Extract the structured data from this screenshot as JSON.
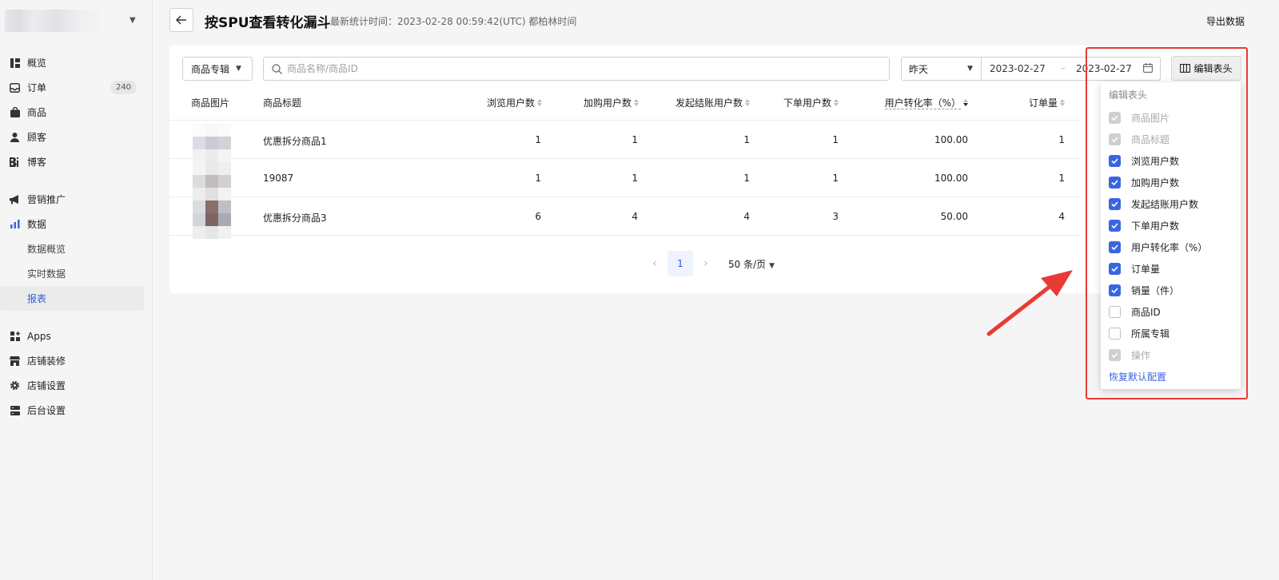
{
  "sidebar": {
    "items": [
      {
        "label": "概览",
        "icon": "overview-icon"
      },
      {
        "label": "订单",
        "icon": "inbox-icon",
        "badge": "240"
      },
      {
        "label": "商品",
        "icon": "bag-icon"
      },
      {
        "label": "顾客",
        "icon": "user-icon"
      },
      {
        "label": "博客",
        "icon": "blog-icon"
      },
      {
        "label": "营销推广",
        "icon": "megaphone-icon"
      },
      {
        "label": "数据",
        "icon": "bar-chart-icon",
        "children": [
          "数据概览",
          "实时数据",
          "报表"
        ]
      },
      {
        "label": "Apps",
        "icon": "apps-icon"
      },
      {
        "label": "店铺装修",
        "icon": "store-icon"
      },
      {
        "label": "店铺设置",
        "icon": "gear-icon"
      },
      {
        "label": "后台设置",
        "icon": "server-icon"
      }
    ],
    "active_sub": "报表"
  },
  "header": {
    "title": "按SPU查看转化漏斗",
    "subtitle": "最新统计时间：2023-02-28 00:59:42(UTC) 都柏林时间",
    "export": "导出数据"
  },
  "filters": {
    "collection_select": "商品专辑",
    "search_placeholder": "商品名称/商品ID",
    "date_preset": "昨天",
    "date_start": "2023-02-27",
    "date_sep": "–",
    "date_end": "2023-02-27",
    "edit_columns": "编辑表头"
  },
  "table": {
    "columns": [
      "商品图片",
      "商品标题",
      "浏览用户数",
      "加购用户数",
      "发起结账用户数",
      "下单用户数",
      "用户转化率（%）",
      "订单量"
    ],
    "rows": [
      {
        "title": "优惠拆分商品1",
        "views": "1",
        "cart": "1",
        "checkout": "1",
        "orders_users": "1",
        "rate": "100.00",
        "orders": "1"
      },
      {
        "title": "19087",
        "views": "1",
        "cart": "1",
        "checkout": "1",
        "orders_users": "1",
        "rate": "100.00",
        "orders": "1"
      },
      {
        "title": "优惠拆分商品3",
        "views": "6",
        "cart": "4",
        "checkout": "4",
        "orders_users": "3",
        "rate": "50.00",
        "orders": "4"
      }
    ]
  },
  "pagination": {
    "current": "1",
    "page_size": "50 条/页"
  },
  "column_popup": {
    "title": "编辑表头",
    "options": [
      {
        "label": "商品图片",
        "state": "disabled"
      },
      {
        "label": "商品标题",
        "state": "disabled"
      },
      {
        "label": "浏览用户数",
        "state": "checked"
      },
      {
        "label": "加购用户数",
        "state": "checked"
      },
      {
        "label": "发起结账用户数",
        "state": "checked"
      },
      {
        "label": "下单用户数",
        "state": "checked"
      },
      {
        "label": "用户转化率（%）",
        "state": "checked"
      },
      {
        "label": "订单量",
        "state": "checked"
      },
      {
        "label": "销量（件）",
        "state": "checked"
      },
      {
        "label": "商品ID",
        "state": "unchecked"
      },
      {
        "label": "所属专辑",
        "state": "unchecked"
      },
      {
        "label": "操作",
        "state": "disabled"
      }
    ],
    "reset": "恢复默认配置"
  },
  "colors": {
    "accent": "#3b65e0",
    "annotation": "#e83b36"
  }
}
